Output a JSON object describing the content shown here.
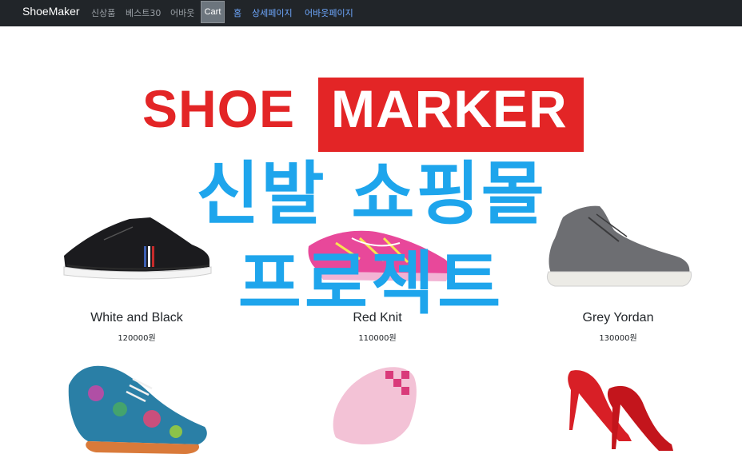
{
  "navbar": {
    "brand": "ShoeMaker",
    "items": [
      {
        "label": "신상품"
      },
      {
        "label": "베스트30"
      },
      {
        "label": "어바웃"
      }
    ],
    "cart_label": "Cart",
    "links": [
      {
        "label": "홈"
      },
      {
        "label": "상세페이지"
      },
      {
        "label": "어바웃페이지"
      }
    ]
  },
  "logo": {
    "part1": "SHOE",
    "part2": "MARKER",
    "color": "#e32526"
  },
  "overlay_title": {
    "line1": "신발 쇼핑몰",
    "line2": "프로젝트",
    "color": "#1ea5ec"
  },
  "products": [
    {
      "name": "White and Black",
      "price": "120000원",
      "image": "black-white-sneaker"
    },
    {
      "name": "Red Knit",
      "price": "110000원",
      "image": "pink-knit-running-shoe"
    },
    {
      "name": "Grey Yordan",
      "price": "130000원",
      "image": "grey-high-top-sneaker"
    },
    {
      "image": "blue-paisley-oxford"
    },
    {
      "image": "pink-checkered-slip-on"
    },
    {
      "image": "red-high-heels"
    }
  ]
}
